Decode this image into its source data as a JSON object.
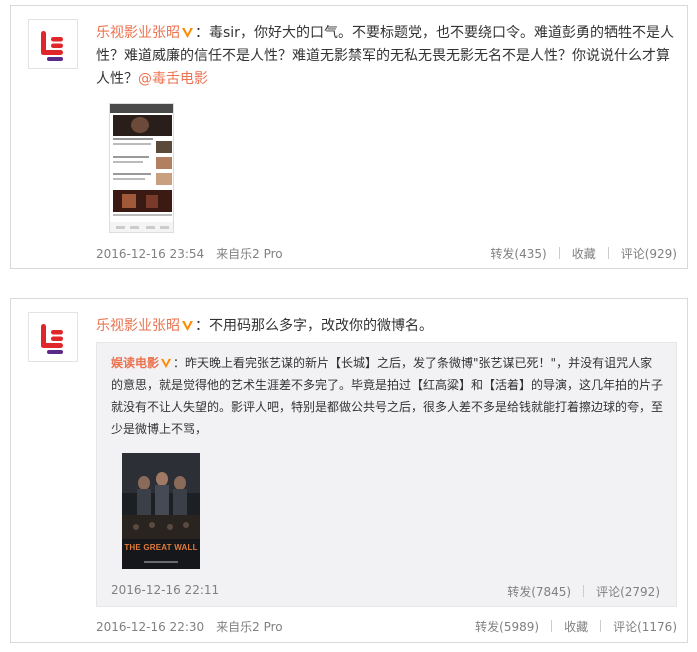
{
  "posts": [
    {
      "author": "乐视影业张昭",
      "colon": "：",
      "text": "毒sir，你好大的口气。不要标题党，也不要绕口令。难道彭勇的牺牲不是人性？难道威廉的信任不是人性？难道无影禁军的无私无畏无影无名不是人性？你说说什么才算人性？",
      "mention": "@毒舌电影",
      "timestamp": "2016-12-16 23:54",
      "source": "来自乐2 Pro",
      "actions": {
        "forward": "转发(435)",
        "favorite": "收藏",
        "comment": "评论(929)"
      }
    },
    {
      "author": "乐视影业张昭",
      "colon": "：",
      "text": "不用码那么多字，改改你的微博名。",
      "timestamp": "2016-12-16 22:30",
      "source": "来自乐2 Pro",
      "actions": {
        "forward": "转发(5989)",
        "favorite": "收藏",
        "comment": "评论(1176)"
      },
      "repost": {
        "author": "娱读电影",
        "colon": "：",
        "text": "昨天晚上看完张艺谋的新片【长城】之后，发了条微博\"张艺谋已死！\"，并没有诅咒人家的意思，就是觉得他的艺术生涯差不多完了。毕竟是拍过【红高粱】和【活着】的导演，这几年拍的片子就没有不让人失望的。影评人吧，特别是都做公共号之后，很多人差不多是给钱就能打着擦边球的夸，至少是微博上不骂，",
        "poster_title": "THE GREAT WALL",
        "timestamp": "2016-12-16 22:11",
        "actions": {
          "forward": "转发(7845)",
          "comment": "评论(2792)"
        }
      }
    }
  ],
  "colors": {
    "accent": "#eb7350",
    "logo_red": "#e0262a",
    "logo_purple": "#5b2a86",
    "vip_orange": "#ff8a00"
  }
}
